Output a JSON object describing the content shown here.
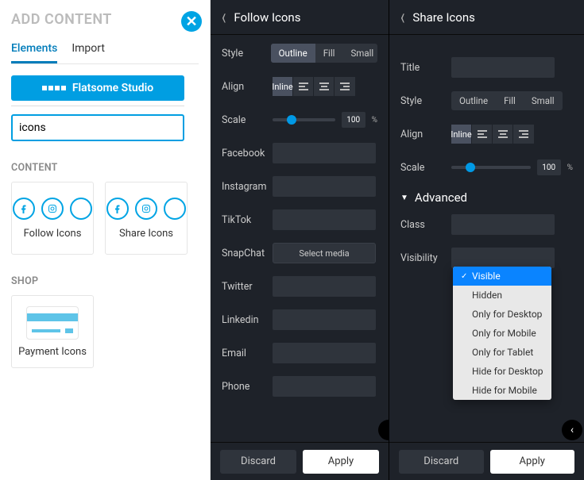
{
  "left": {
    "title": "ADD CONTENT",
    "tabs": {
      "elements": "Elements",
      "import": "Import"
    },
    "studio_btn": "Flatsome Studio",
    "search_value": "icons",
    "content_title": "CONTENT",
    "shop_title": "SHOP",
    "cards": {
      "follow": "Follow Icons",
      "share": "Share Icons",
      "payment": "Payment Icons"
    }
  },
  "follow_panel": {
    "title": "Follow Icons",
    "labels": {
      "style": "Style",
      "align": "Align",
      "scale": "Scale",
      "facebook": "Facebook",
      "instagram": "Instagram",
      "tiktok": "TikTok",
      "snapchat": "SnapChat",
      "twitter": "Twitter",
      "linkedin": "Linkedin",
      "email": "Email",
      "phone": "Phone"
    },
    "style_opts": {
      "outline": "Outline",
      "fill": "Fill",
      "small": "Small"
    },
    "align_inline": "Inline",
    "scale_val": "100",
    "scale_unit": "%",
    "select_media": "Select media",
    "discard": "Discard",
    "apply": "Apply"
  },
  "share_panel": {
    "title": "Share Icons",
    "labels": {
      "title": "Title",
      "style": "Style",
      "align": "Align",
      "scale": "Scale",
      "class": "Class",
      "visibility": "Visibility"
    },
    "style_opts": {
      "outline": "Outline",
      "fill": "Fill",
      "small": "Small"
    },
    "align_inline": "Inline",
    "scale_val": "100",
    "scale_unit": "%",
    "advanced": "Advanced",
    "visibility_opts": [
      "Visible",
      "Hidden",
      "Only for Desktop",
      "Only for Mobile",
      "Only for Tablet",
      "Hide for Desktop",
      "Hide for Mobile"
    ],
    "visibility_selected": "Visible",
    "discard": "Discard",
    "apply": "Apply"
  }
}
